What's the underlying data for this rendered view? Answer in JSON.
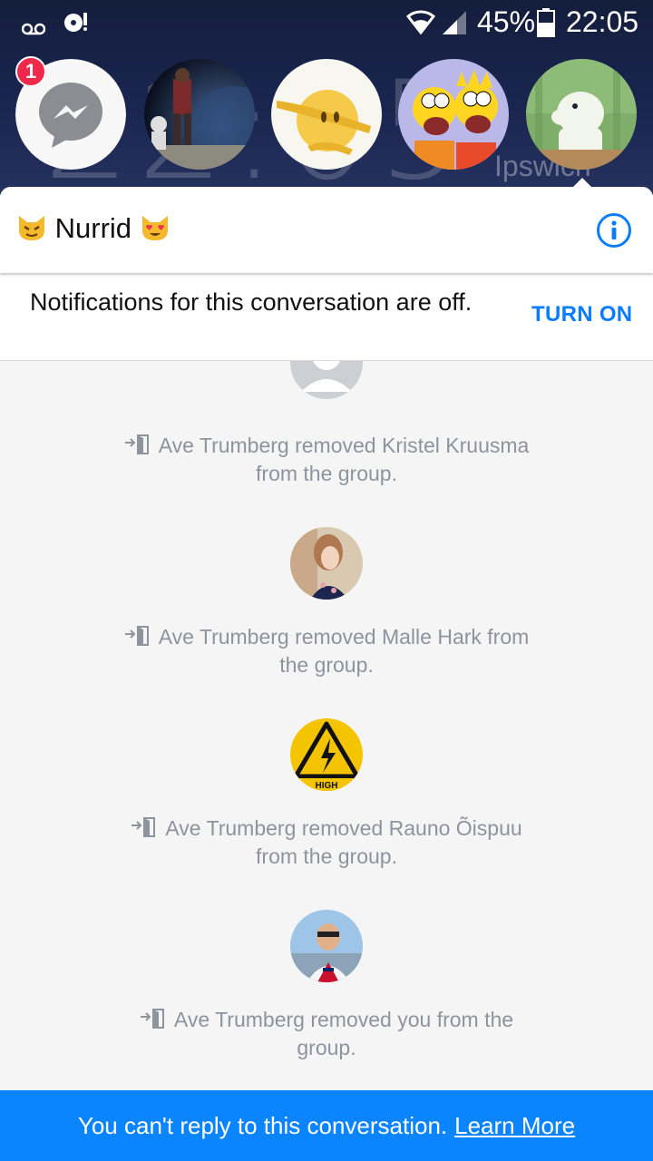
{
  "status_bar": {
    "battery_percent": "45%",
    "time": "22:05",
    "icons": [
      "voicemail-icon",
      "sync-icon",
      "wifi-icon",
      "signal-icon",
      "battery-icon"
    ]
  },
  "wallpaper": {
    "clock": "22:05",
    "location": "Ipswich"
  },
  "chat_heads": {
    "badge_count": "1",
    "heads": [
      {
        "name": "messenger-chat-head",
        "icon": "messenger-icon"
      },
      {
        "name": "astronaut-chat-head"
      },
      {
        "name": "dab-emoji-chat-head"
      },
      {
        "name": "simpsons-chat-head"
      },
      {
        "name": "moomin-chat-head"
      }
    ]
  },
  "conversation": {
    "title": "Nurrid",
    "title_emoji_left": "cat-face-icon",
    "title_emoji_right": "heart-eyes-cat-icon"
  },
  "notification_banner": {
    "text": "Notifications for this conversation are off.",
    "action": "TURN ON"
  },
  "events": [
    {
      "text": "Ave Trumberg removed Kristel Kruusma from the group."
    },
    {
      "text": "Ave Trumberg removed Malle Hark from the group."
    },
    {
      "text": "Ave Trumberg removed Rauno Õispuu from the group."
    },
    {
      "text": "Ave Trumberg removed you from the group."
    }
  ],
  "high_voltage_sign_text": "HIGH",
  "footer": {
    "text": "You can't reply to this conversation.",
    "link": "Learn More"
  },
  "colors": {
    "accent": "#0a7cff",
    "footer_bg": "#0a84ff",
    "badge": "#f02849",
    "event_text": "#8d949e"
  }
}
